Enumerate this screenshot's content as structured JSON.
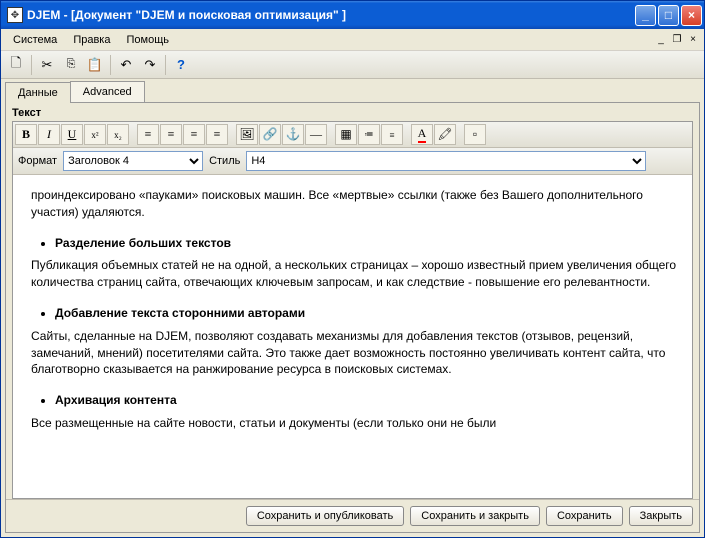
{
  "window": {
    "app": "DJEM",
    "title": "DJEM -  [Документ \"DJEM и поисковая оптимизация\" ]"
  },
  "menu": {
    "system": "Система",
    "edit": "Правка",
    "help": "Помощь"
  },
  "tabs": {
    "data": "Данные",
    "advanced": "Advanced"
  },
  "editor": {
    "section_label": "Текст",
    "format_label": "Формат",
    "format_value": "Заголовок 4",
    "style_label": "Стиль",
    "style_value": "H4"
  },
  "content": {
    "p1_a": " проиндексировано «пауками» поисковых машин. Все «мертвые» ссылки (также без Вашего дополнительного участия) удаляются.",
    "h1": "Разделение больших текстов",
    "p2": "Публикация объемных статей не на одной, а нескольких страницах – хорошо известный прием увеличения общего количества страниц сайта, отвечающих ключевым запросам, и как следствие - повышение  его релевантности.",
    "h2": "Добавление текста  сторонними авторами",
    "p3": "Сайты, сделанные на DJEM,  позволяют создавать механизмы для добавления  текстов (отзывов, рецензий, замечаний, мнений) посетителями сайта. Это также дает возможность постоянно увеличивать контент сайта, что благотворно сказывается на ранжирование ресурса в поисковых системах.",
    "h3": "Архивация контента",
    "p4": "Все размещенные на сайте новости, статьи и документы  (если только они не были"
  },
  "buttons": {
    "save_publish": "Сохранить и опубликовать",
    "save_close": "Сохранить и закрыть",
    "save": "Сохранить",
    "close": "Закрыть"
  }
}
